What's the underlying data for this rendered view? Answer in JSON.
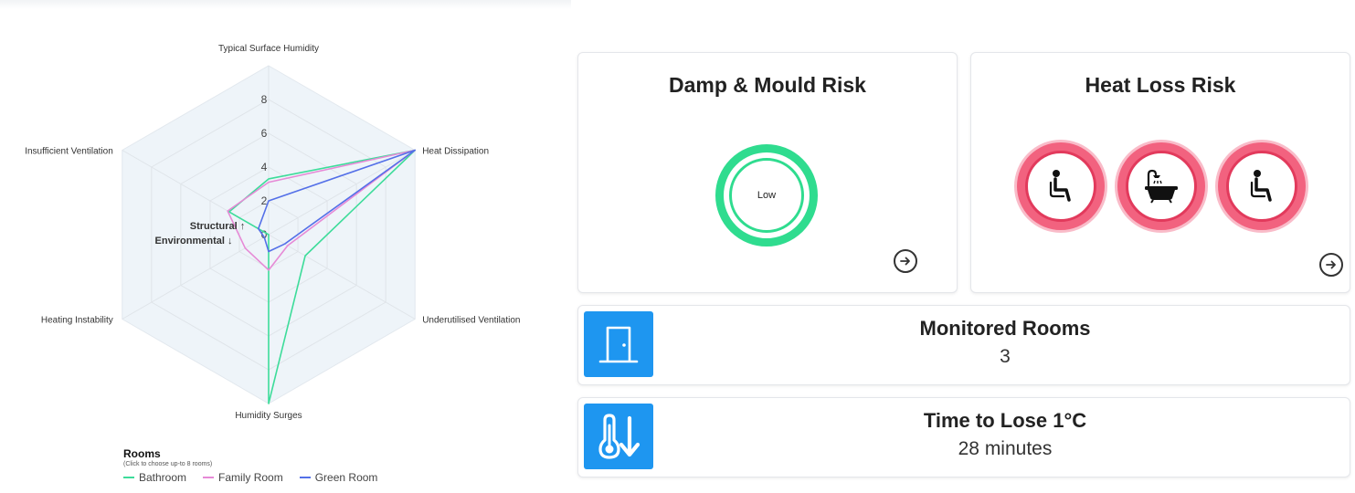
{
  "chart_data": {
    "type": "radar",
    "axes": [
      "Typical Surface Humidity",
      "Heat Dissipation",
      "Underutilised Ventilation",
      "Humidity Surges",
      "Heating Instability",
      "Insufficient Ventilation"
    ],
    "ticks": [
      "0",
      "2",
      "4",
      "6",
      "8"
    ],
    "rlim": [
      0,
      10
    ],
    "center_labels": [
      "Structural ↑",
      "Environmental ↓"
    ],
    "series": [
      {
        "name": "Bathroom",
        "color": "#3ddc9a",
        "values": [
          3.3,
          10,
          2.5,
          10,
          0,
          2.7
        ]
      },
      {
        "name": "Family Room",
        "color": "#e68ad6",
        "values": [
          3.1,
          10,
          1.3,
          2.1,
          1.6,
          2.8
        ]
      },
      {
        "name": "Green Room",
        "color": "#5470e8",
        "values": [
          2.0,
          10,
          1.1,
          1.0,
          0.3,
          0.7
        ]
      }
    ],
    "grid": true
  },
  "legend": {
    "title": "Rooms",
    "hint": "(Click to choose up-to 8 rooms)"
  },
  "damp_card": {
    "title": "Damp & Mould Risk",
    "risk_label": "Low",
    "risk_color": "#2fdc8f"
  },
  "heat_card": {
    "title": "Heat Loss Risk",
    "risk_color": "#f2627f",
    "icons": [
      "seated-person-icon",
      "bathtub-shower-icon",
      "seated-person-icon"
    ]
  },
  "monitored_rooms": {
    "title": "Monitored Rooms",
    "value": "3",
    "icon": "door-icon"
  },
  "time_to_lose": {
    "title": "Time to Lose 1°C",
    "value": "28 minutes",
    "icon": "thermometer-down-icon"
  },
  "colors": {
    "accent": "#1e96f0"
  }
}
